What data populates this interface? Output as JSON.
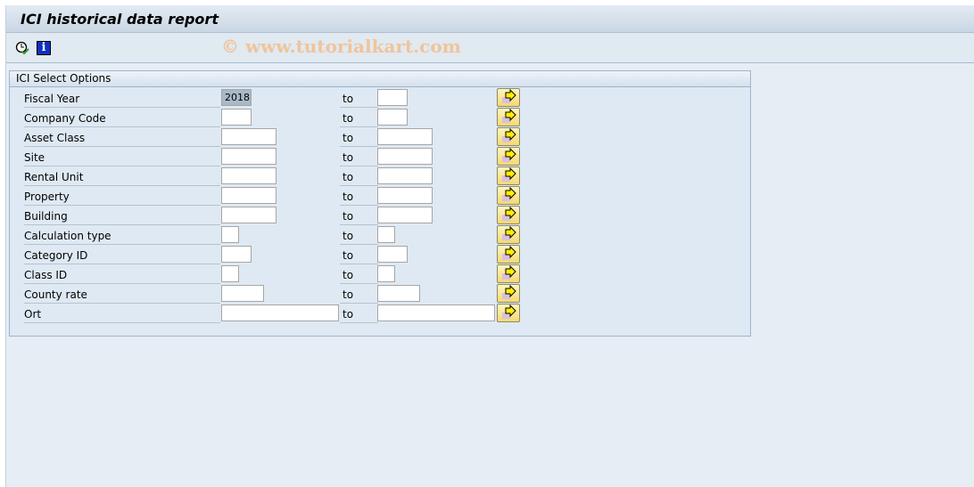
{
  "title": "ICI historical data report",
  "toolbar": {
    "icons": [
      "execute-clock-icon",
      "info-icon"
    ],
    "watermark": "© www.tutorialkart.com"
  },
  "group": {
    "title": "ICI Select Options",
    "to_label": "to",
    "rows": [
      {
        "label": "Fiscal Year",
        "from": "2018",
        "to": ""
      },
      {
        "label": "Company Code",
        "from": "",
        "to": ""
      },
      {
        "label": "Asset Class",
        "from": "",
        "to": ""
      },
      {
        "label": "Site",
        "from": "",
        "to": ""
      },
      {
        "label": "Rental Unit",
        "from": "",
        "to": ""
      },
      {
        "label": "Property",
        "from": "",
        "to": ""
      },
      {
        "label": "Building",
        "from": "",
        "to": ""
      },
      {
        "label": "Calculation type",
        "from": "",
        "to": ""
      },
      {
        "label": "Category ID",
        "from": "",
        "to": ""
      },
      {
        "label": "Class ID",
        "from": "",
        "to": ""
      },
      {
        "label": "County rate",
        "from": "",
        "to": ""
      },
      {
        "label": "Ort",
        "from": "",
        "to": ""
      }
    ]
  }
}
